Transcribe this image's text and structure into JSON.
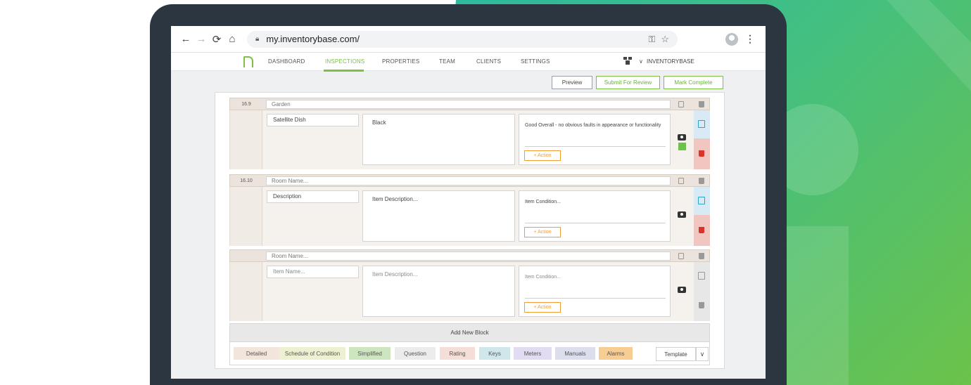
{
  "browser": {
    "url": "my.inventorybase.com/",
    "icons": [
      "back-arrow-icon",
      "forward-arrow-icon",
      "reload-icon",
      "home-icon",
      "lock-icon",
      "key-icon",
      "star-icon",
      "account-icon",
      "kebab-menu-icon"
    ]
  },
  "nav": {
    "items": [
      "DASHBOARD",
      "INSPECTIONS",
      "PROPERTIES",
      "TEAM",
      "CLIENTS",
      "SETTINGS"
    ],
    "active": "INSPECTIONS",
    "org_name": "INVENTORYBASE",
    "org_chevron": "∨"
  },
  "toolbar": {
    "preview": "Preview",
    "submit": "Submit For Review",
    "complete": "Mark Complete"
  },
  "rooms": [
    {
      "number": "16.9",
      "name": "Garden",
      "item_name": "Satellite Dish",
      "description": "Black",
      "condition": "Good Overall - no obvious faults in appearance or functionality",
      "action": "+ Action"
    },
    {
      "number": "16.10",
      "name": "Room Name...",
      "item_name": "Description",
      "description": "Item Description...",
      "condition": "Item Condition...",
      "action": "+ Action"
    },
    {
      "number": "",
      "name": "Room Name...",
      "item_name": "Item Name...",
      "description": "Item Description...",
      "condition": "Item Condition...",
      "action": "+ Action"
    }
  ],
  "add_block": {
    "title": "Add New Block",
    "types": [
      {
        "label": "Detailed",
        "color": "#f2e5dc"
      },
      {
        "label": "Schedule of Condition",
        "color": "#eef0d2"
      },
      {
        "label": "Simplified",
        "color": "#cde6c0"
      },
      {
        "label": "Question",
        "color": "#ececec"
      },
      {
        "label": "Rating",
        "color": "#f5ddd8"
      },
      {
        "label": "Keys",
        "color": "#cfe7ea"
      },
      {
        "label": "Meters",
        "color": "#e1dcf1"
      },
      {
        "label": "Manuals",
        "color": "#dcdded"
      },
      {
        "label": "Alarms",
        "color": "#f8cd94"
      }
    ],
    "template": "Template",
    "template_caret": "∨"
  },
  "colors": {
    "brand_green": "#7cc142",
    "action_orange": "#f39c34",
    "copy_blue": "#29a3c9",
    "delete_red": "#d9342b"
  }
}
